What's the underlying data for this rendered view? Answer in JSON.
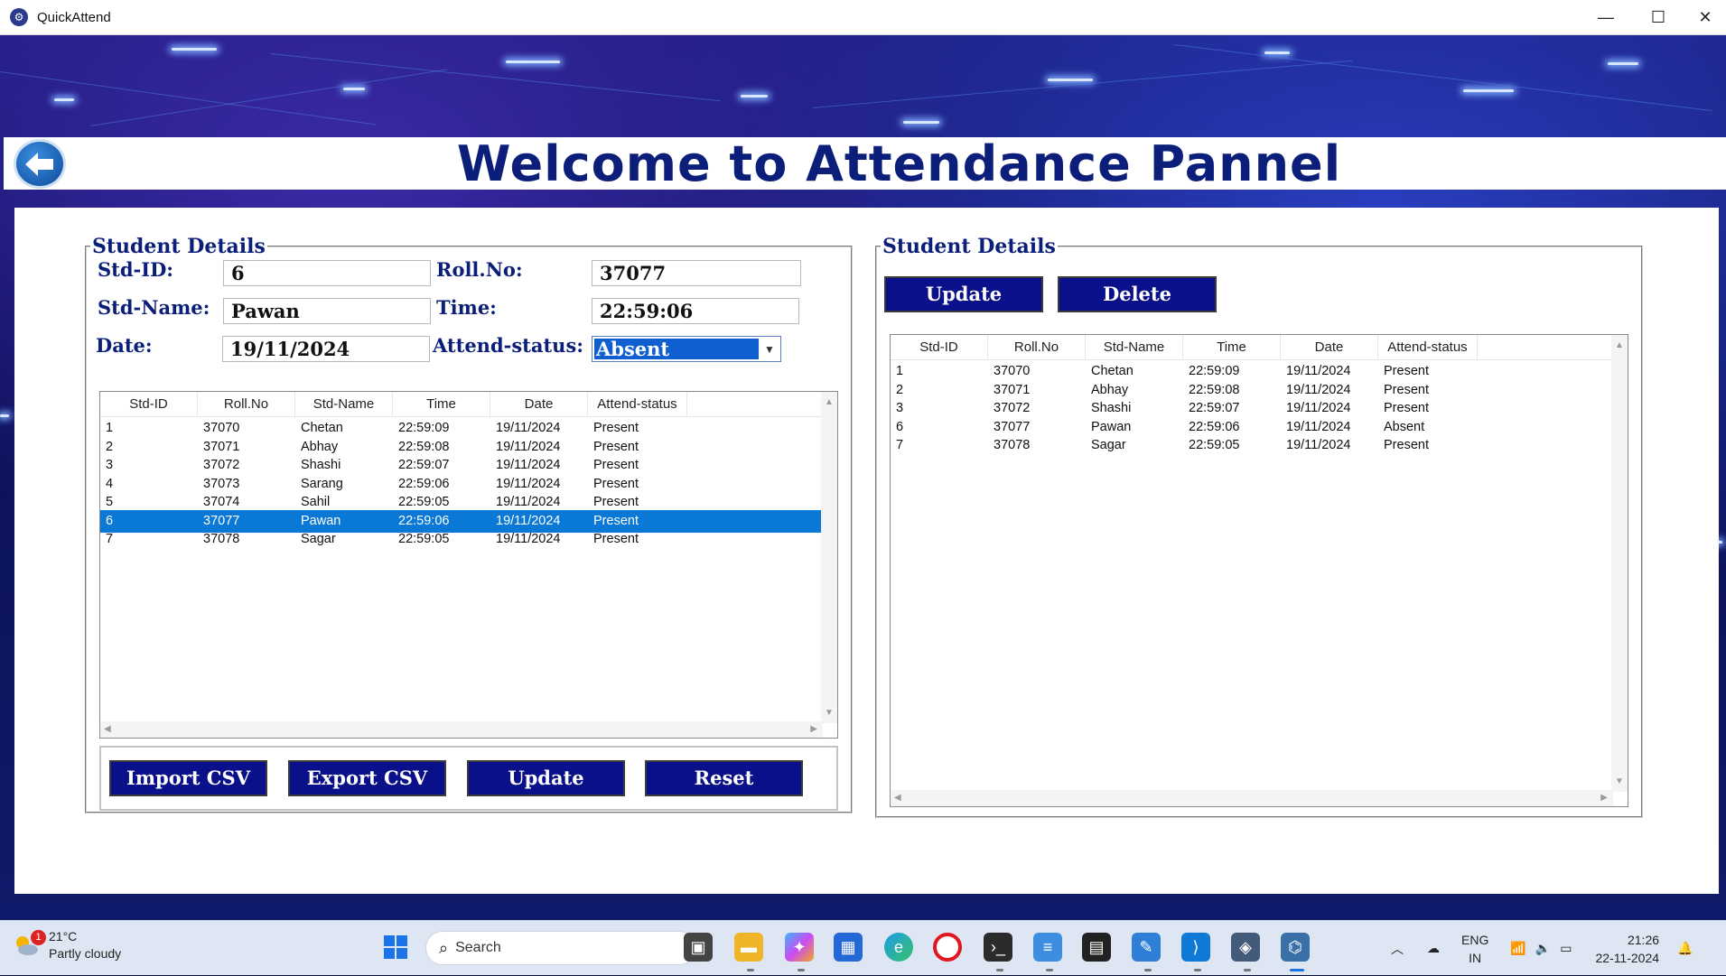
{
  "window": {
    "title": "QuickAttend",
    "minimize": "—",
    "maximize": "☐",
    "close": "✕"
  },
  "page_title": "Welcome to Attendance Pannel",
  "form": {
    "legend": "Student Details",
    "std_id_label": "Std-ID:",
    "std_id_value": "6",
    "roll_label": "Roll.No:",
    "roll_value": "37077",
    "name_label": "Std-Name:",
    "name_value": "Pawan",
    "time_label": "Time:",
    "time_value": "22:59:06",
    "date_label": "Date:",
    "date_value": "19/11/2024",
    "status_label": "Attend-status:",
    "status_value": "Absent"
  },
  "left_table": {
    "columns": [
      "Std-ID",
      "Roll.No",
      "Std-Name",
      "Time",
      "Date",
      "Attend-status"
    ],
    "rows": [
      [
        "1",
        "37070",
        "Chetan",
        "22:59:09",
        "19/11/2024",
        "Present"
      ],
      [
        "2",
        "37071",
        "Abhay",
        "22:59:08",
        "19/11/2024",
        "Present"
      ],
      [
        "3",
        "37072",
        "Shashi",
        "22:59:07",
        "19/11/2024",
        "Present"
      ],
      [
        "4",
        "37073",
        "Sarang",
        "22:59:06",
        "19/11/2024",
        "Present"
      ],
      [
        "5",
        "37074",
        "Sahil",
        "22:59:05",
        "19/11/2024",
        "Present"
      ],
      [
        "6",
        "37077",
        "Pawan",
        "22:59:06",
        "19/11/2024",
        "Present"
      ],
      [
        "7",
        "37078",
        "Sagar",
        "22:59:05",
        "19/11/2024",
        "Present"
      ]
    ],
    "selected_row": "6"
  },
  "left_buttons": {
    "import": "Import CSV",
    "export": "Export CSV",
    "update": "Update",
    "reset": "Reset"
  },
  "right_panel": {
    "legend": "Student Details",
    "update": "Update",
    "delete": "Delete",
    "columns": [
      "Std-ID",
      "Roll.No",
      "Std-Name",
      "Time",
      "Date",
      "Attend-status"
    ],
    "rows": [
      [
        "1",
        "37070",
        "Chetan",
        "22:59:09",
        "19/11/2024",
        "Present"
      ],
      [
        "2",
        "37071",
        "Abhay",
        "22:59:08",
        "19/11/2024",
        "Present"
      ],
      [
        "3",
        "37072",
        "Shashi",
        "22:59:07",
        "19/11/2024",
        "Present"
      ],
      [
        "6",
        "37077",
        "Pawan",
        "22:59:06",
        "19/11/2024",
        "Absent"
      ],
      [
        "7",
        "37078",
        "Sagar",
        "22:59:05",
        "19/11/2024",
        "Present"
      ]
    ]
  },
  "taskbar": {
    "weather_temp": "21°C",
    "weather_desc": "Partly cloudy",
    "weather_badge": "1",
    "search_placeholder": "Search",
    "lang_top": "ENG",
    "lang_bottom": "IN",
    "time": "21:26",
    "date": "22-11-2024"
  },
  "icons": [
    "app-icon",
    "back-arrow-icon",
    "windows-start-icon",
    "search-icon",
    "file-explorer-icon",
    "copilot-icon",
    "store-icon",
    "edge-icon",
    "opera-icon",
    "terminal-icon",
    "notepad-icon",
    "vscode-icon",
    "python-icon",
    "wifi-icon",
    "volume-icon",
    "battery-icon",
    "cloud-icon",
    "notification-bell-icon"
  ]
}
